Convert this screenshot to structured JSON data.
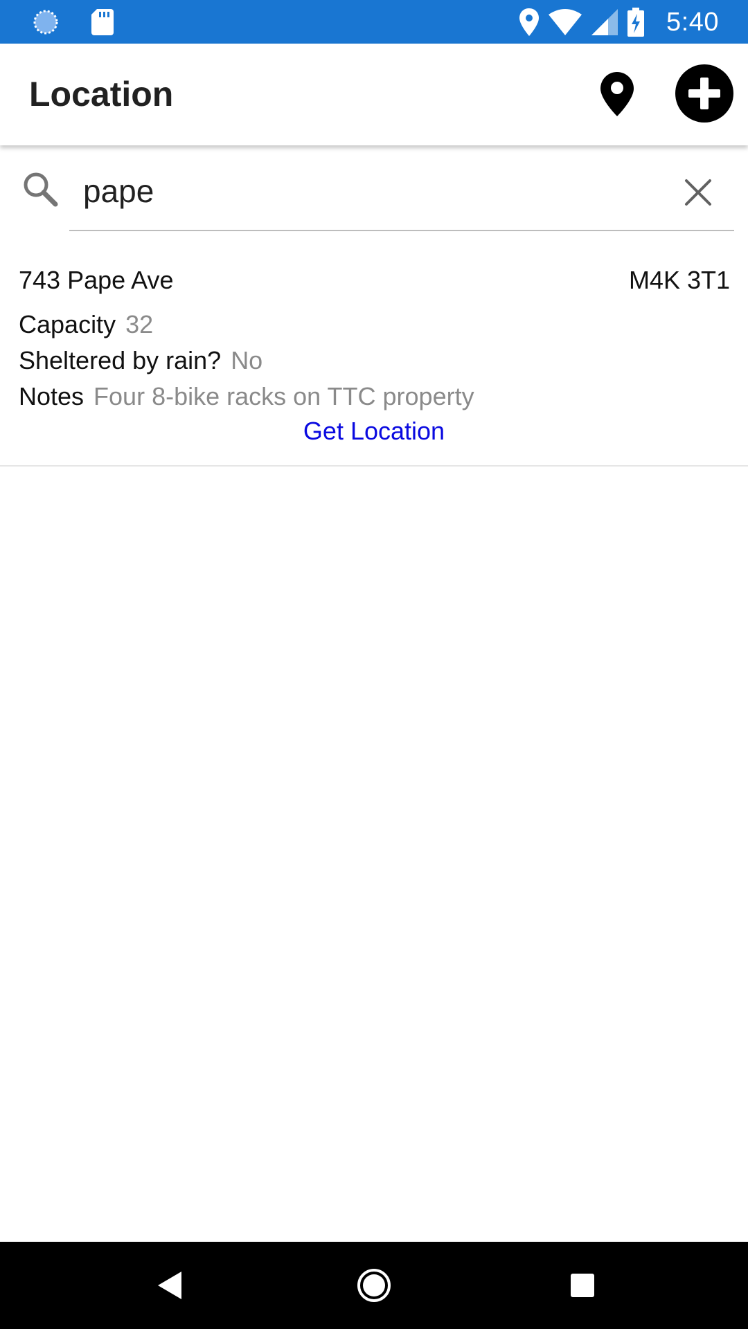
{
  "status_bar": {
    "time": "5:40",
    "left_icons": [
      "loading-spinner-icon",
      "sd-card-icon"
    ],
    "right_icons": [
      "location-icon",
      "wifi-icon",
      "cell-signal-icon",
      "battery-charging-icon"
    ],
    "color": "#1976D2"
  },
  "app_bar": {
    "title": "Location",
    "actions": [
      "map-pin-icon",
      "add-circle-icon"
    ]
  },
  "search": {
    "value": "pape",
    "icon": "search-icon",
    "clear_icon": "close-icon"
  },
  "results": [
    {
      "address": "743 Pape Ave",
      "postal_code": "M4K 3T1",
      "capacity_label": "Capacity",
      "capacity_value": "32",
      "sheltered_label": "Sheltered by rain?",
      "sheltered_value": "No",
      "notes_label": "Notes",
      "notes_value": "Four 8-bike racks on TTC property",
      "action_label": "Get Location"
    }
  ],
  "colors": {
    "link": "#0A0AE0",
    "secondary_text": "#8A8A8A"
  },
  "nav_bar": {
    "buttons": [
      "back-icon",
      "home-icon",
      "recents-icon"
    ]
  }
}
